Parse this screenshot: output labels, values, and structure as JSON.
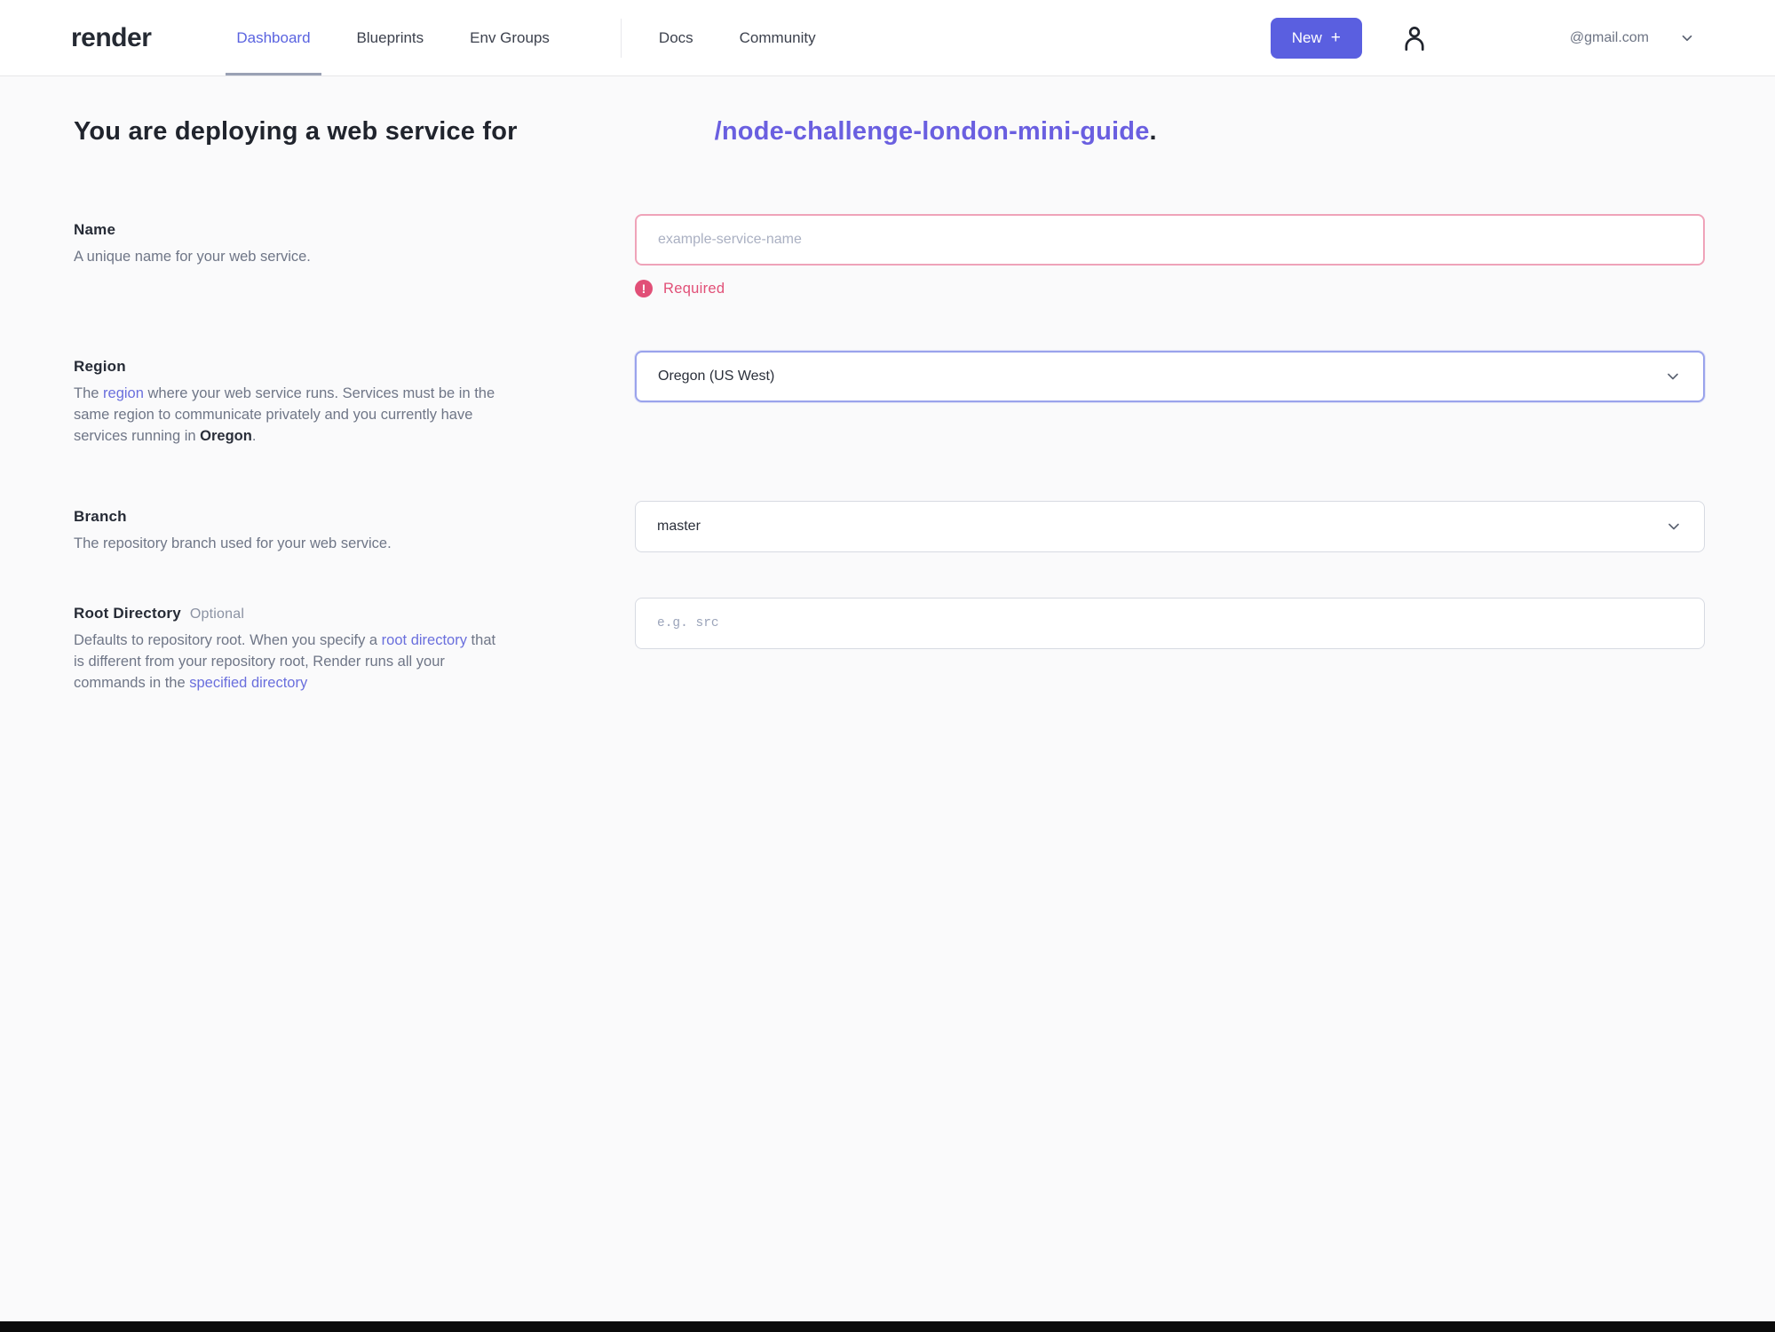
{
  "nav": {
    "logo": "render",
    "items": [
      {
        "label": "Dashboard"
      },
      {
        "label": "Blueprints"
      },
      {
        "label": "Env Groups"
      }
    ],
    "secondary_items": [
      {
        "label": "Docs"
      },
      {
        "label": "Community"
      }
    ],
    "new_button_label": "New",
    "new_button_plus": "+",
    "account_email": "@gmail.com"
  },
  "heading": {
    "prefix": "You are deploying a web service for",
    "repo_link": "/node-challenge-london-mini-guide",
    "suffix": "."
  },
  "form": {
    "name": {
      "label": "Name",
      "description": "A unique name for your web service.",
      "placeholder": "example-service-name",
      "error": "Required",
      "error_icon_glyph": "!"
    },
    "region": {
      "label": "Region",
      "desc_part1": "The ",
      "desc_link": "region",
      "desc_part2": " where your web service runs. Services must be in the same region to communicate privately and you currently have services running in ",
      "desc_bold": "Oregon",
      "desc_part3": ".",
      "value": "Oregon (US West)"
    },
    "branch": {
      "label": "Branch",
      "description": "The repository branch used for your web service.",
      "value": "master"
    },
    "root_directory": {
      "label": "Root Directory",
      "optional_tag": "Optional",
      "desc_part1": "Defaults to repository root. When you specify a ",
      "desc_link1": "root directory",
      "desc_part2": " that is different from your repository root, Render runs all your commands in the ",
      "desc_link2": "specified directory",
      "placeholder": "e.g. src"
    }
  },
  "colors": {
    "accent_indigo": "#5a5fe0",
    "link_purple": "#6a5fe0",
    "error_pink": "#e14f77"
  }
}
